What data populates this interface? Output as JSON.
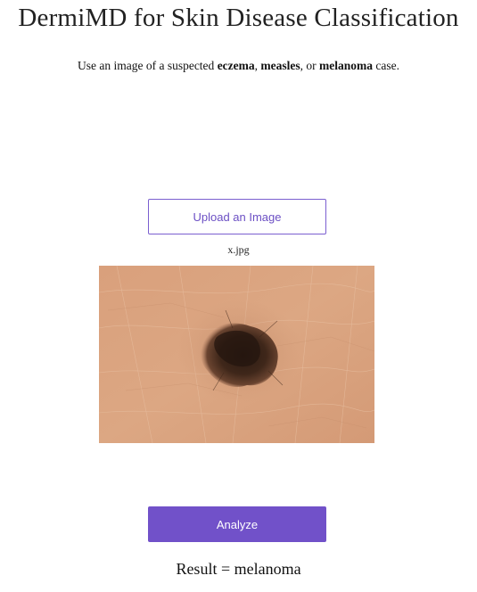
{
  "page": {
    "title": "DermiMD for Skin Disease Classification",
    "instructions": {
      "prefix": "Use an image of a suspected ",
      "option_1": "eczema",
      "sep_1": ", ",
      "option_2": "measles",
      "sep_2": ", or ",
      "option_3": "melanoma",
      "suffix": " case."
    }
  },
  "upload": {
    "button_label": "Upload an Image",
    "filename": "x.jpg"
  },
  "preview": {
    "image": "skin-lesion-photo",
    "colors": {
      "skin": "#d9a27e",
      "lesion": "#3a2418"
    }
  },
  "analyze": {
    "button_label": "Analyze"
  },
  "result": {
    "text": "Result = melanoma"
  },
  "colors": {
    "accent": "#7151c9",
    "upload_border": "#7b5fd0"
  }
}
